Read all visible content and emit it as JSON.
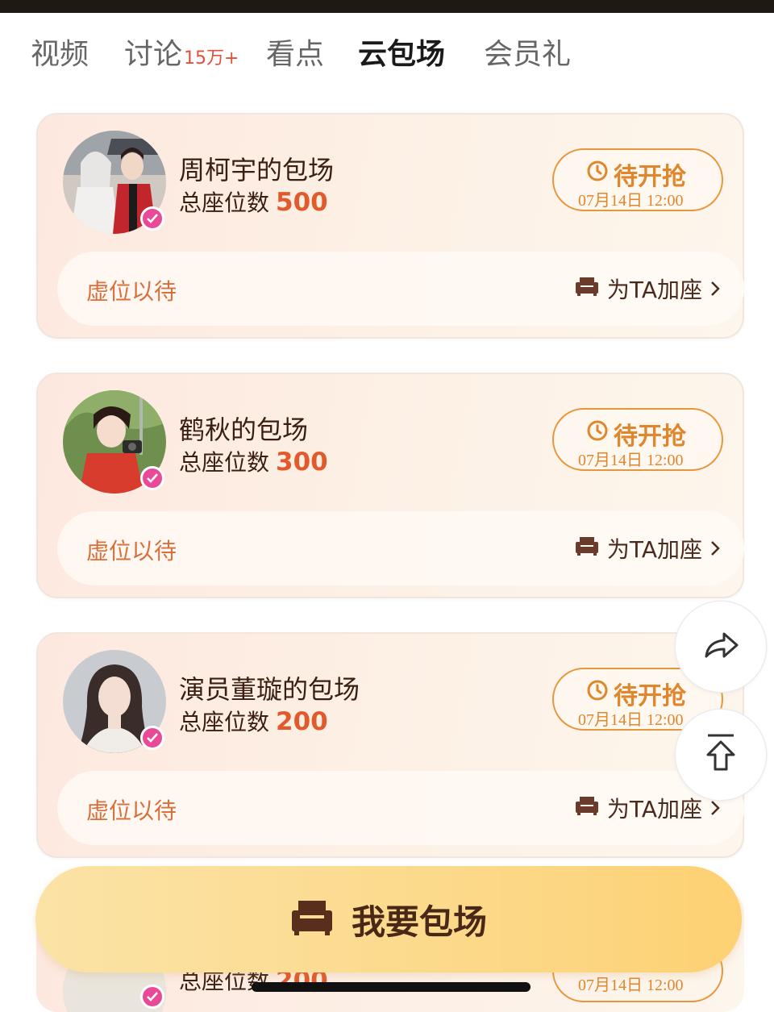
{
  "tabs": [
    {
      "label": "视频",
      "count": ""
    },
    {
      "label": "讨论",
      "count": "15万+"
    },
    {
      "label": "看点",
      "count": ""
    },
    {
      "label": "云包场",
      "count": "",
      "active": true
    },
    {
      "label": "会员礼",
      "count": ""
    }
  ],
  "cards": [
    {
      "name": "周柯宇的包场",
      "seats_label": "总座位数",
      "seats": "500",
      "status": "待开抢",
      "time": "07月14日 12:00",
      "vacant": "虚位以待",
      "add_seat": "为TA加座"
    },
    {
      "name": "鹤秋的包场",
      "seats_label": "总座位数",
      "seats": "300",
      "status": "待开抢",
      "time": "07月14日 12:00",
      "vacant": "虚位以待",
      "add_seat": "为TA加座"
    },
    {
      "name": "演员董璇的包场",
      "seats_label": "总座位数",
      "seats": "200",
      "status": "待开抢",
      "time": "07月14日 12:00",
      "vacant": "虚位以待",
      "add_seat": "为TA加座"
    }
  ],
  "partial_card": {
    "seats_label": "总座位数",
    "seats": "200",
    "time": "07月14日 12:00"
  },
  "cta": {
    "label": "我要包场",
    "icon": "sofa-icon"
  },
  "floating": {
    "share_icon": "share-icon",
    "top_icon": "back-to-top-icon"
  },
  "colors": {
    "accent": "#e0862d",
    "seats_number": "#e25a2c",
    "verified_badge": "#e94a98",
    "cta_bg": "#fcd98a"
  }
}
